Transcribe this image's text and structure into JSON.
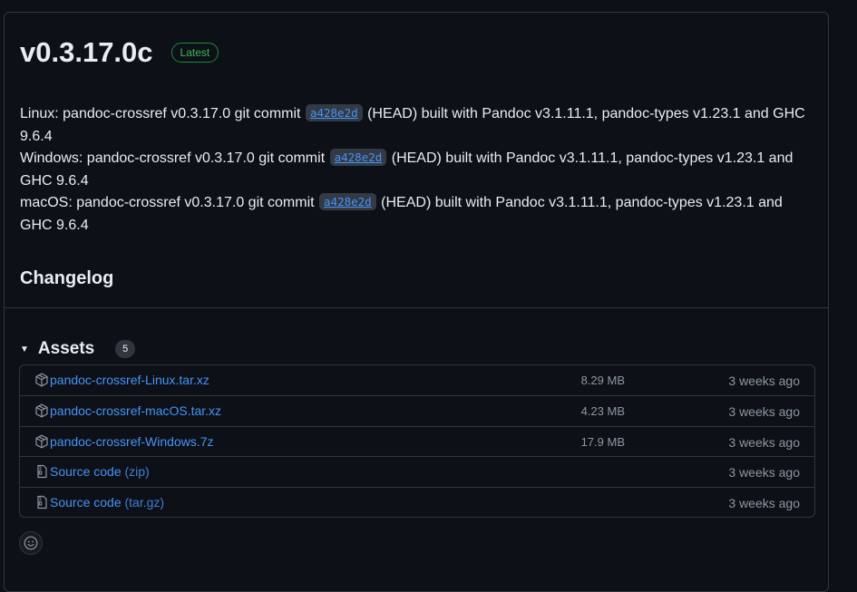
{
  "release": {
    "title": "v0.3.17.0c",
    "badge": "Latest"
  },
  "notes": [
    {
      "prefix": "Linux: pandoc-crossref v0.3.17.0 git commit",
      "commit": "a428e2d",
      "suffix": "(HEAD) built with Pandoc v3.1.11.1, pandoc-types v1.23.1 and GHC 9.6.4"
    },
    {
      "prefix": "Windows: pandoc-crossref v0.3.17.0 git commit",
      "commit": "a428e2d",
      "suffix": "(HEAD) built with Pandoc v3.1.11.1, pandoc-types v1.23.1 and GHC 9.6.4"
    },
    {
      "prefix": "macOS: pandoc-crossref v0.3.17.0 git commit",
      "commit": "a428e2d",
      "suffix": "(HEAD) built with Pandoc v3.1.11.1, pandoc-types v1.23.1 and GHC 9.6.4"
    }
  ],
  "changelog_heading": "Changelog",
  "assets": {
    "title": "Assets",
    "count": "5",
    "items": [
      {
        "icon": "package-icon",
        "name": "pandoc-crossref-Linux.tar.xz",
        "suffix": "",
        "size": "8.29 MB",
        "date": "3 weeks ago"
      },
      {
        "icon": "package-icon",
        "name": "pandoc-crossref-macOS.tar.xz",
        "suffix": "",
        "size": "4.23 MB",
        "date": "3 weeks ago"
      },
      {
        "icon": "package-icon",
        "name": "pandoc-crossref-Windows.7z",
        "suffix": "",
        "size": "17.9 MB",
        "date": "3 weeks ago"
      },
      {
        "icon": "file-zip-icon",
        "name": "Source code",
        "suffix": "(zip)",
        "size": "",
        "date": "3 weeks ago"
      },
      {
        "icon": "file-zip-icon",
        "name": "Source code",
        "suffix": "(tar.gz)",
        "size": "",
        "date": "3 weeks ago"
      }
    ]
  },
  "reaction": {
    "icon": "smiley-icon"
  },
  "colors": {
    "background": "#0d1117",
    "border": "#30363d",
    "link": "#4493f8",
    "latest_green": "#3fb950",
    "muted": "#8d96a0"
  }
}
